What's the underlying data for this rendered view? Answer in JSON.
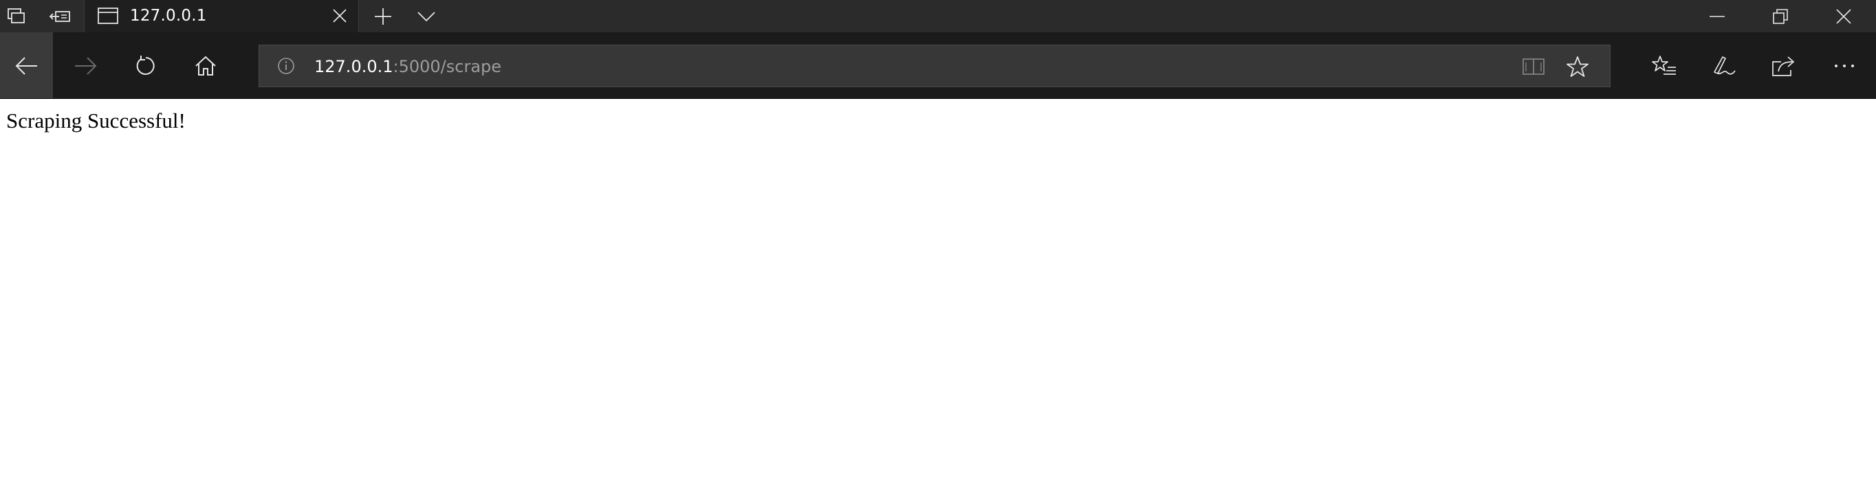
{
  "tab": {
    "title": "127.0.0.1"
  },
  "address_bar": {
    "url_host": "127.0.0.1",
    "url_path": ":5000/scrape"
  },
  "page": {
    "message": "Scraping Successful!"
  },
  "icons": {
    "tab_switcher": "tab-switcher-icon",
    "set_aside": "set-aside-tabs-icon",
    "favicon": "page-favicon-icon",
    "close_tab": "close-icon",
    "new_tab": "plus-icon",
    "tab_preview": "chevron-down-icon",
    "minimize": "minimize-icon",
    "restore": "restore-icon",
    "close_window": "close-icon",
    "back": "back-arrow-icon",
    "forward": "forward-arrow-icon",
    "refresh": "refresh-icon",
    "home": "home-icon",
    "site_info": "info-icon",
    "reading_view": "book-icon",
    "favorite": "star-icon",
    "favorites_hub": "favorites-list-icon",
    "web_note": "pen-icon",
    "share": "share-icon",
    "more": "more-icon"
  },
  "colors": {
    "titlebar_bg": "#2b2b2b",
    "toolbar_bg": "#1b1b1b",
    "addressbar_bg": "#373737",
    "page_bg": "#ffffff"
  }
}
